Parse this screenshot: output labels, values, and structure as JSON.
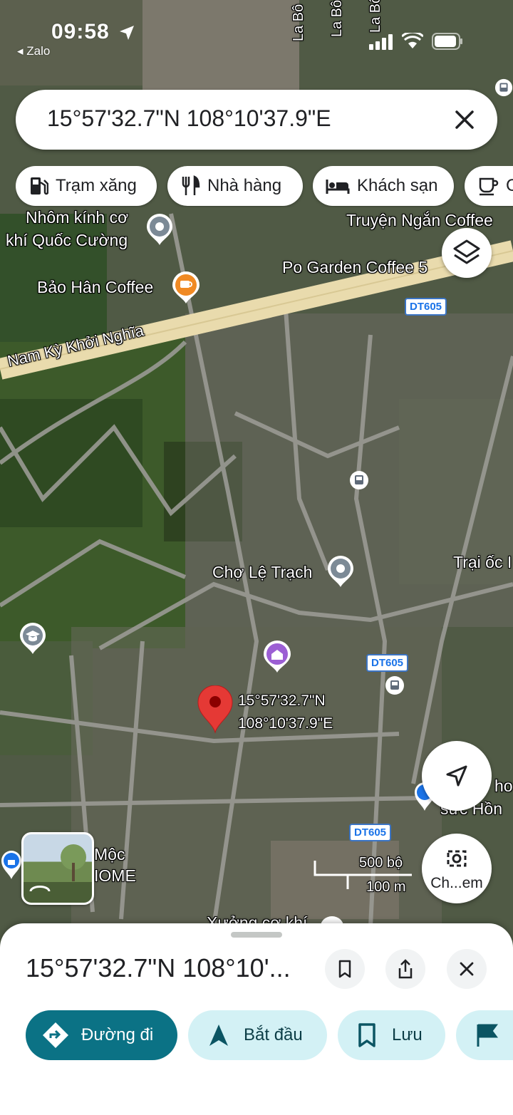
{
  "status_bar": {
    "time": "09:58",
    "back_app": "Zalo"
  },
  "search": {
    "query": "15°57'32.7\"N 108°10'37.9\"E"
  },
  "chips": [
    {
      "label": "Trạm xăng",
      "icon": "gas-station-icon"
    },
    {
      "label": "Nhà hàng",
      "icon": "restaurant-icon"
    },
    {
      "label": "Khách sạn",
      "icon": "hotel-icon"
    },
    {
      "label": "C",
      "icon": "coffee-icon"
    }
  ],
  "map": {
    "street_labels": {
      "top_1": "La Bô",
      "top_2": "La Bô",
      "top_3": "La Bô",
      "highway": "Nam Kỳ Khởi Nghĩa"
    },
    "places": {
      "nhom_kinh_1": "Nhôm kính cơ",
      "nhom_kinh_2": "khí Quốc Cường",
      "truyen_ngan": "Truyện Ngắn Coffee",
      "po_garden": "Po Garden Coffee 5",
      "bao_han": "Bảo Hân Coffee",
      "cho_le_trach": "Chợ Lệ Trạch",
      "trai_oc": "Trại ốc I",
      "moc_1": "Mộc",
      "moc_2": "IOME",
      "right_1": "ho",
      "right_2": "sức Hồn",
      "xuong": "Xưởng cơ khí"
    },
    "route_shields": [
      "DT605",
      "DT605",
      "DT605"
    ],
    "pin_label_line1": "15°57'32.7\"N",
    "pin_label_line2": "108°10'37.9\"E",
    "scale": {
      "imperial": "500 bộ",
      "metric": "100 m"
    },
    "street_view_button": "Ch...em"
  },
  "sheet": {
    "title": "15°57'32.7\"N 108°10'...",
    "actions": [
      {
        "label": "Đường đi",
        "icon": "directions-icon"
      },
      {
        "label": "Bắt đầu",
        "icon": "navigation-arrow-icon"
      },
      {
        "label": "Lưu",
        "icon": "bookmark-icon"
      }
    ]
  },
  "colors": {
    "primary": "#0b7285",
    "tonal": "#d3f1f5",
    "pin": "#e53935",
    "road": "#e9dbad"
  }
}
